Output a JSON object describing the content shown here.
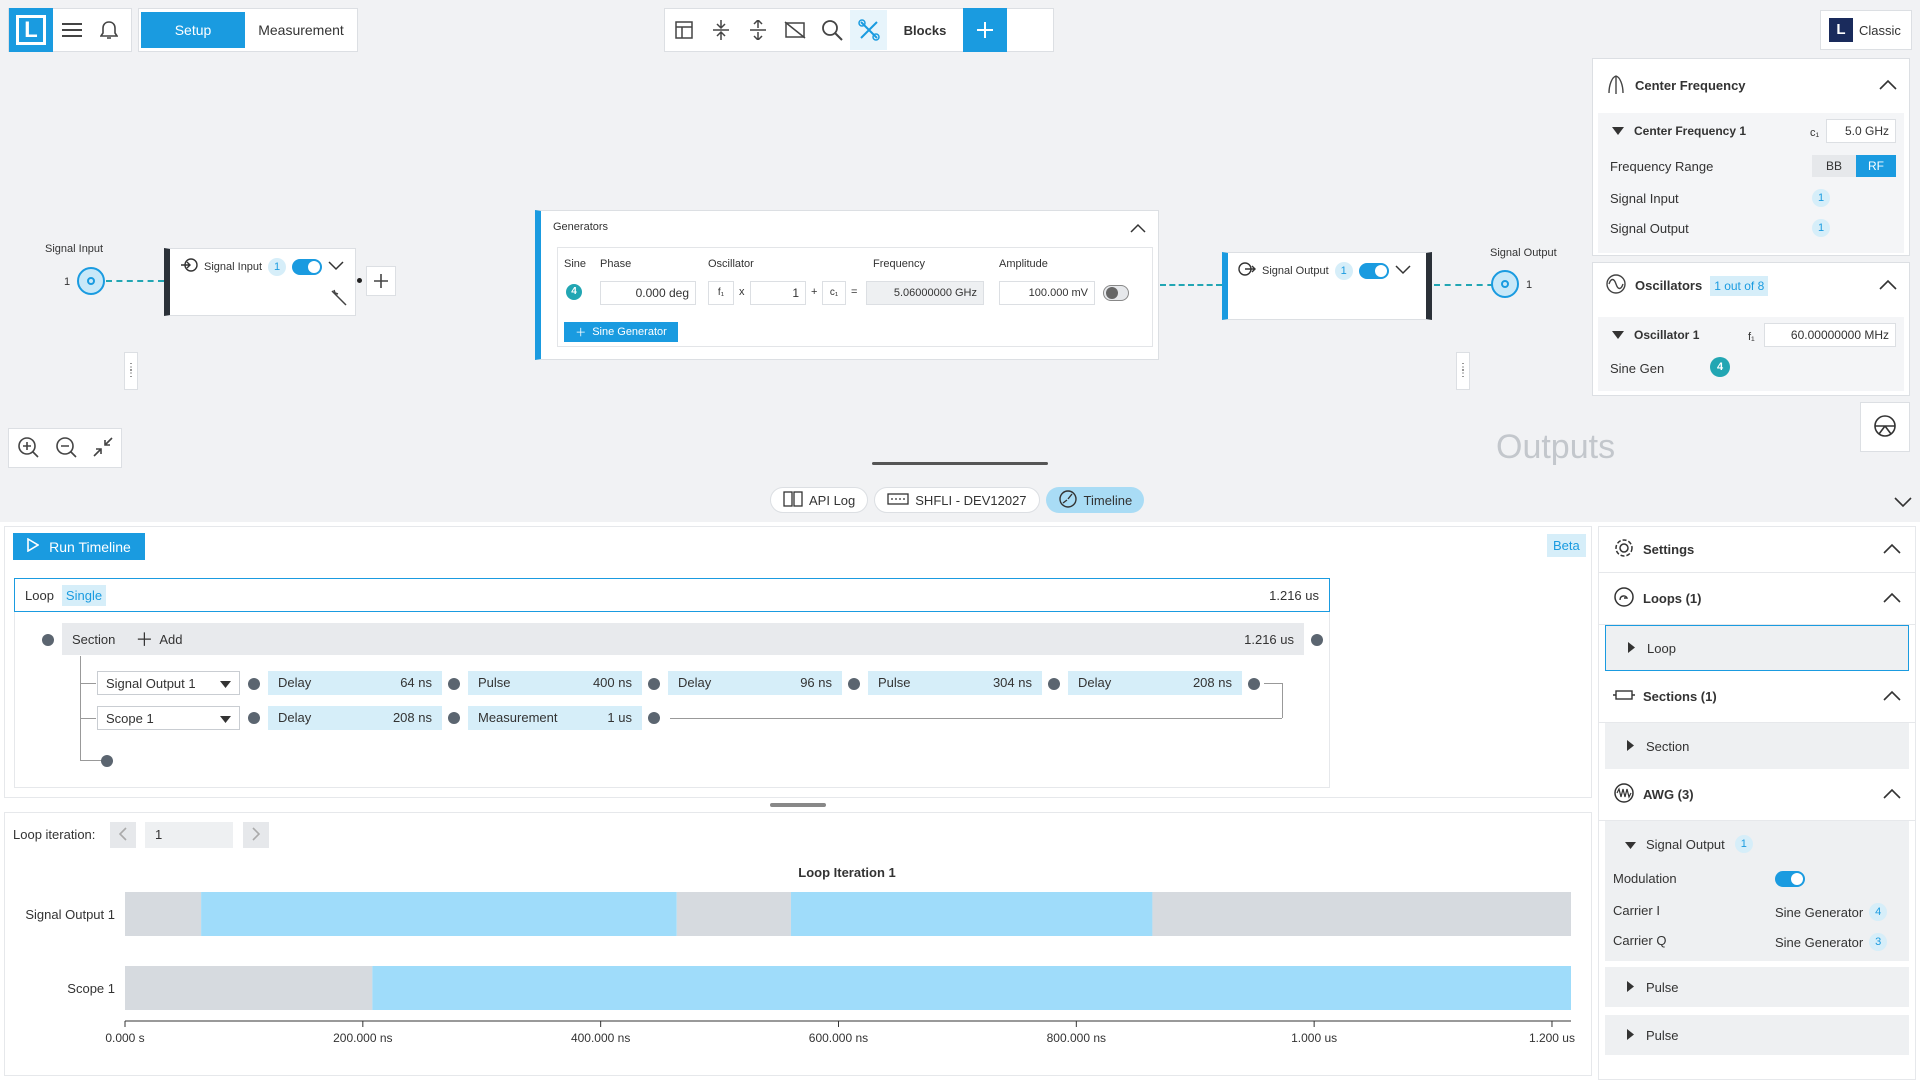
{
  "toolbar": {
    "logo": "L",
    "tabs": [
      {
        "label": "Setup",
        "active": true
      },
      {
        "label": "Measurement",
        "active": false
      }
    ],
    "blocks_label": "Blocks",
    "classic_label": "Classic"
  },
  "diagram": {
    "signal_input_port": {
      "label": "Signal Input",
      "num": "1"
    },
    "signal_input_block": {
      "label": "Signal Input",
      "badge": "1"
    },
    "signal_output_block": {
      "label": "Signal Output",
      "badge": "1"
    },
    "signal_output_port": {
      "label": "Signal Output",
      "num": "1"
    },
    "generators": {
      "title": "Generators",
      "headers": [
        "Sine",
        "Phase",
        "Oscillator",
        "Frequency",
        "Amplitude"
      ],
      "row": {
        "sine": "4",
        "phase": "0.000 deg",
        "osc_prefix": "f₁",
        "times": "x",
        "osc_mult": "1",
        "plus": "+",
        "c_prefix": "c₁",
        "equals": "=",
        "frequency": "5.06000000 GHz",
        "amplitude": "100.000 mV"
      },
      "add_button": "Sine Generator"
    },
    "outputs_watermark": "Outputs"
  },
  "right_panel": {
    "center_frequency": {
      "title": "Center Frequency",
      "item_label": "Center Frequency 1",
      "item_prefix": "c₁",
      "item_value": "5.0 GHz",
      "freq_range_label": "Frequency Range",
      "freq_range_options": [
        "BB",
        "RF"
      ],
      "freq_range_selected": "RF",
      "signal_input_label": "Signal Input",
      "signal_input_value": "1",
      "signal_output_label": "Signal Output",
      "signal_output_value": "1"
    },
    "oscillators": {
      "title": "Oscillators",
      "badge": "1 out of 8",
      "item_label": "Oscillator 1",
      "item_prefix": "f₁",
      "item_value": "60.00000000 MHz",
      "sine_gen_label": "Sine Gen",
      "sine_gen_value": "4"
    }
  },
  "bottom_tabs": [
    {
      "label": "API Log",
      "icon": "book-icon",
      "active": false
    },
    {
      "label": "SHFLI - DEV12027",
      "icon": "device-icon",
      "active": false
    },
    {
      "label": "Timeline",
      "icon": "timeline-icon",
      "active": true
    }
  ],
  "timeline": {
    "run_label": "Run Timeline",
    "beta_label": "Beta",
    "loop": {
      "label": "Loop",
      "mode": "Single",
      "duration": "1.216 us"
    },
    "section": {
      "label": "Section",
      "add_label": "Add",
      "duration": "1.216 us"
    },
    "rows": [
      {
        "select": "Signal Output 1",
        "items": [
          {
            "label": "Delay",
            "value": "64 ns"
          },
          {
            "label": "Pulse",
            "value": "400 ns"
          },
          {
            "label": "Delay",
            "value": "96 ns"
          },
          {
            "label": "Pulse",
            "value": "304 ns"
          },
          {
            "label": "Delay",
            "value": "208 ns"
          }
        ]
      },
      {
        "select": "Scope 1",
        "items": [
          {
            "label": "Delay",
            "value": "208 ns"
          },
          {
            "label": "Measurement",
            "value": "1 us"
          }
        ]
      }
    ]
  },
  "iteration": {
    "label": "Loop iteration:",
    "value": "1",
    "plot_title": "Loop Iteration 1",
    "chart_data": {
      "type": "bar",
      "title": "Loop Iteration 1",
      "categories": [
        "Signal Output 1",
        "Scope 1"
      ],
      "xlim": [
        0,
        1.216
      ],
      "x_unit": "us",
      "xticks": [
        "0.000 s",
        "200.000 ns",
        "400.000 ns",
        "600.000 ns",
        "800.000 ns",
        "1.000 us",
        "1.200 us"
      ],
      "xtick_values": [
        0,
        0.2,
        0.4,
        0.6,
        0.8,
        1.0,
        1.2
      ],
      "segments": [
        {
          "row": "Signal Output 1",
          "kind": "Delay",
          "start": 0,
          "end": 0.064
        },
        {
          "row": "Signal Output 1",
          "kind": "Pulse",
          "start": 0.064,
          "end": 0.464
        },
        {
          "row": "Signal Output 1",
          "kind": "Delay",
          "start": 0.464,
          "end": 0.56
        },
        {
          "row": "Signal Output 1",
          "kind": "Pulse",
          "start": 0.56,
          "end": 0.864
        },
        {
          "row": "Signal Output 1",
          "kind": "Delay",
          "start": 0.864,
          "end": 1.216
        },
        {
          "row": "Scope 1",
          "kind": "Delay",
          "start": 0,
          "end": 0.208
        },
        {
          "row": "Scope 1",
          "kind": "Measurement",
          "start": 0.208,
          "end": 1.216
        }
      ],
      "colors": {
        "Delay": "#d6dadf",
        "Pulse": "#9fdcfa",
        "Measurement": "#9fdcfa"
      }
    }
  },
  "settings": {
    "title": "Settings",
    "loops_title": "Loops (1)",
    "loop_item": "Loop",
    "sections_title": "Sections (1)",
    "section_item": "Section",
    "awg_title": "AWG (3)",
    "awg_output_label": "Signal Output",
    "awg_output_badge": "1",
    "modulation_label": "Modulation",
    "carrier_i_label": "Carrier I",
    "carrier_i_value": "Sine Generator",
    "carrier_i_badge": "4",
    "carrier_q_label": "Carrier Q",
    "carrier_q_value": "Sine Generator",
    "carrier_q_badge": "3",
    "pulse_items": [
      "Pulse",
      "Pulse"
    ]
  }
}
